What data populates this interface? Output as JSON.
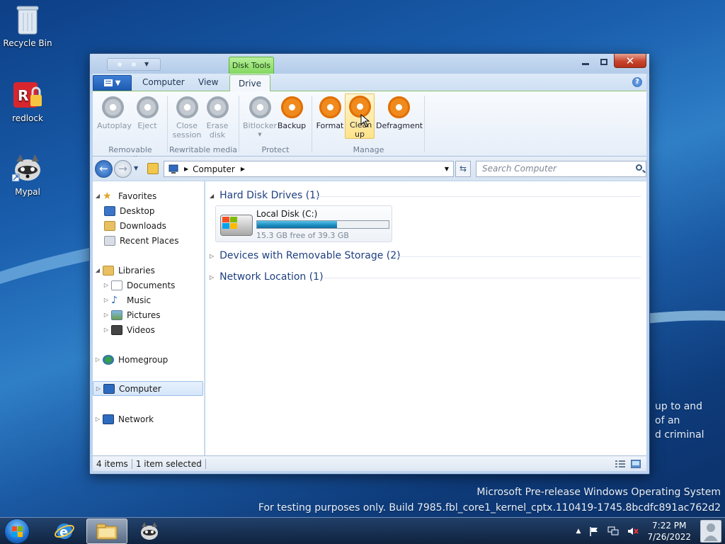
{
  "desktop": {
    "icons": [
      {
        "label": "Recycle Bin"
      },
      {
        "label": "redlock"
      },
      {
        "label": "Mypal"
      }
    ],
    "background_text": [
      "up to and",
      "of an",
      "d criminal"
    ],
    "watermark": {
      "line1": "Microsoft Pre-release Windows Operating System",
      "line2": "For testing purposes only. Build 7985.fbl_core1_kernel_cptx.110419-1745.8bcdfc891ac762d2"
    }
  },
  "window": {
    "contextual_tab": "Disk Tools",
    "tabs": [
      {
        "label": "Computer"
      },
      {
        "label": "View"
      },
      {
        "label": "Drive",
        "active": true
      }
    ],
    "ribbon": {
      "groups": [
        {
          "label": "Removable media",
          "buttons": [
            {
              "label": "Autoplay",
              "enabled": false
            },
            {
              "label": "Eject",
              "enabled": false
            }
          ]
        },
        {
          "label": "Rewritable media",
          "buttons": [
            {
              "label": "Close session",
              "enabled": false
            },
            {
              "label": "Erase disk",
              "enabled": false
            }
          ]
        },
        {
          "label": "Protect",
          "buttons": [
            {
              "label": "Bitlocker",
              "enabled": false
            },
            {
              "label": "Backup",
              "enabled": true
            }
          ]
        },
        {
          "label": "Manage",
          "buttons": [
            {
              "label": "Format",
              "enabled": true
            },
            {
              "label": "Clean up",
              "enabled": true,
              "hover": true
            },
            {
              "label": "Defragment",
              "enabled": true
            }
          ]
        }
      ]
    },
    "address": {
      "path": "Computer",
      "search_placeholder": "Search Computer"
    },
    "nav_pane": {
      "favorites": {
        "label": "Favorites",
        "items": [
          "Desktop",
          "Downloads",
          "Recent Places"
        ]
      },
      "libraries": {
        "label": "Libraries",
        "items": [
          "Documents",
          "Music",
          "Pictures",
          "Videos"
        ]
      },
      "homegroup": "Homegroup",
      "computer": "Computer",
      "network": "Network"
    },
    "content": {
      "groups": [
        {
          "label": "Hard Disk Drives (1)",
          "expanded": true
        },
        {
          "label": "Devices with Removable Storage (2)",
          "expanded": false
        },
        {
          "label": "Network Location (1)",
          "expanded": false
        }
      ],
      "drive": {
        "name": "Local Disk (C:)",
        "free_text": "15.3 GB free of 39.3 GB",
        "used_fraction": 0.61
      }
    },
    "status": {
      "items": "4 items",
      "selection": "1 item selected"
    }
  },
  "taskbar": {
    "time": "7:22 PM",
    "date": "7/26/2022"
  },
  "colors": {
    "accent_orange": "#f08a1d",
    "context_green": "#7fd65a",
    "close_red": "#c8452d"
  }
}
